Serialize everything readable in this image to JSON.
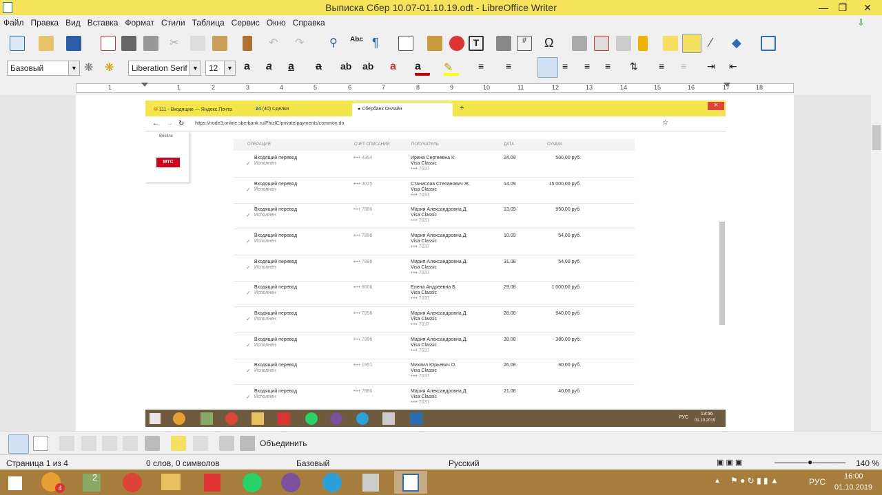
{
  "window": {
    "title": "Выписка Сбер 10.07-01.10.19.odt - LibreOffice Writer"
  },
  "menu": [
    "Файл",
    "Правка",
    "Вид",
    "Вставка",
    "Формат",
    "Стили",
    "Таблица",
    "Сервис",
    "Окно",
    "Справка"
  ],
  "format_bar": {
    "style": "Базовый",
    "font": "Liberation Serif",
    "size": "12"
  },
  "ruler_ticks": [
    "1",
    "1",
    "2",
    "3",
    "4",
    "5",
    "6",
    "7",
    "8",
    "9",
    "10",
    "11",
    "12",
    "13",
    "14",
    "15",
    "16",
    "17",
    "18"
  ],
  "browser": {
    "tabs": [
      "111 - Входящие — Яндекс.Почта",
      "(40) Сделки",
      "Сбербанк Онлайн"
    ],
    "tab_badge": "24",
    "url": "https://node3.online.sberbank.ru/PhizIC/private/payments/common.do",
    "side": {
      "beeline": "Beeline",
      "mts": "МТС"
    }
  },
  "table": {
    "headers": {
      "op": "ОПЕРАЦИЯ",
      "acc": "СЧЕТ СПИСАНИЯ",
      "rcp": "ПОЛУЧАТЕЛЬ",
      "date": "ДАТА",
      "sum": "СУММА"
    },
    "rows": [
      {
        "op": "Входящий перевод",
        "st": "Исполнен",
        "acc": "•••• 4364",
        "name": "Ирина Сергеевна К.",
        "card": "Visa Classic",
        "num": "•••• 7037",
        "date": "24.09",
        "sum": "500,00 руб."
      },
      {
        "op": "Входящий перевод",
        "st": "Исполнен",
        "acc": "•••• 3025",
        "name": "Станислав Степанович Ж.",
        "card": "Visa Classic",
        "num": "•••• 7037",
        "date": "14.09",
        "sum": "15 000,00 руб."
      },
      {
        "op": "Входящий перевод",
        "st": "Исполнен",
        "acc": "•••• 7896",
        "name": "Мария Александровна Д.",
        "card": "Visa Classic",
        "num": "•••• 7037",
        "date": "13.09",
        "sum": "950,00 руб."
      },
      {
        "op": "Входящий перевод",
        "st": "Исполнен",
        "acc": "•••• 7896",
        "name": "Мария Александровна Д.",
        "card": "Visa Classic",
        "num": "•••• 7037",
        "date": "10.09",
        "sum": "54,00 руб."
      },
      {
        "op": "Входящий перевод",
        "st": "Исполнен",
        "acc": "•••• 7896",
        "name": "Мария Александровна Д.",
        "card": "Visa Classic",
        "num": "•••• 7037",
        "date": "31.08",
        "sum": "54,00 руб."
      },
      {
        "op": "Входящий перевод",
        "st": "Исполнен",
        "acc": "•••• 8606",
        "name": "Елена Андреевна Б.",
        "card": "Visa Classic",
        "num": "•••• 7037",
        "date": "29.08",
        "sum": "1 000,00 руб."
      },
      {
        "op": "Входящий перевод",
        "st": "Исполнен",
        "acc": "•••• 7896",
        "name": "Мария Александровна Д.",
        "card": "Visa Classic",
        "num": "•••• 7037",
        "date": "28.08",
        "sum": "940,00 руб."
      },
      {
        "op": "Входящий перевод",
        "st": "Исполнен",
        "acc": "•••• 7896",
        "name": "Мария Александровна Д.",
        "card": "Visa Classic",
        "num": "•••• 7037",
        "date": "28.08",
        "sum": "380,00 руб."
      },
      {
        "op": "Входящий перевод",
        "st": "Исполнен",
        "acc": "•••• 1951",
        "name": "Михаил Юрьевич О.",
        "card": "Visa Classic",
        "num": "•••• 7037",
        "date": "26.08",
        "sum": "30,00 руб."
      },
      {
        "op": "Входящий перевод",
        "st": "Исполнен",
        "acc": "•••• 7896",
        "name": "Мария Александровна Д.",
        "card": "Visa Classic",
        "num": "•••• 7037",
        "date": "21.08",
        "sum": "40,00 руб."
      }
    ]
  },
  "embedded_tray": {
    "lang": "РУС",
    "time": "13:56",
    "date": "01.10.2019"
  },
  "bottom_toolbar": {
    "merge_label": "Объединить"
  },
  "status": {
    "page": "Страница 1 из 4",
    "words": "0 слов, 0 символов",
    "style": "Базовый",
    "lang": "Русский",
    "zoom": "140 %"
  },
  "taskbar": {
    "lang": "РУС",
    "time": "16:00",
    "date": "01.10.2019",
    "badge": "4",
    "badge2": "2"
  }
}
